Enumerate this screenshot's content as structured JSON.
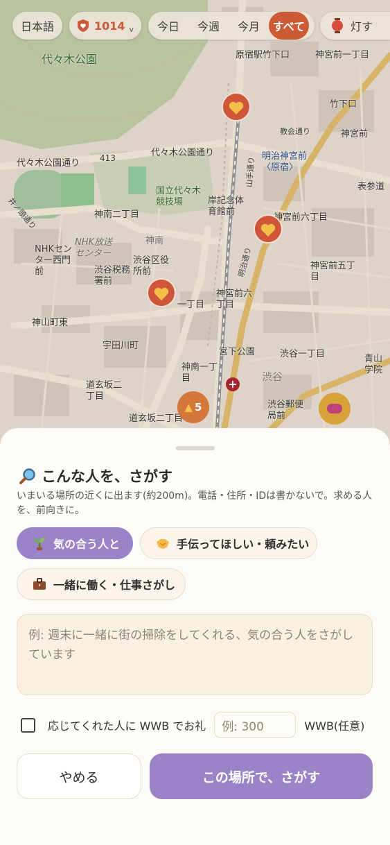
{
  "topbar": {
    "language": "日本語",
    "points": "1014",
    "points_chevron": "v",
    "periods": [
      "今日",
      "今週",
      "今月",
      "すべて"
    ],
    "active_period": "すべて",
    "lantern_label": "灯す"
  },
  "map": {
    "labels": [
      "代々木公園",
      "原宿駅竹下口",
      "神宮前一丁目",
      "竹下口",
      "教会通り",
      "明治神宮前〈原宿〉",
      "神宮前",
      "代々木公園通り",
      "代々木公園通り",
      "413",
      "国立代々木競技場",
      "岸記念体育館前",
      "神宮前六丁目",
      "神南二丁目",
      "神南",
      "NHK放送センター",
      "NHKセンター西門前",
      "渋谷税務署前",
      "渋谷区役所前",
      "神宮前五丁目",
      "神宮前六丁目",
      "一丁目",
      "神山町東",
      "宇田川町",
      "宮下公園",
      "渋谷一丁目",
      "神南一丁目",
      "道玄坂二丁目",
      "渋谷郵便局前",
      "道玄坂二丁目",
      "渋谷",
      "表参道",
      "井ノ頭通り",
      "明治通り",
      "山手通り",
      "青山学院"
    ],
    "cluster_count": "5"
  },
  "sheet": {
    "title": "こんな人を、さがす",
    "description": "いまいる場所の近くに出ます(約200m)。電話・住所・IDは書かないで。求める人を、前向きに。",
    "categories": [
      {
        "label": "気の合う人と",
        "icon": "seedling-icon",
        "active": true
      },
      {
        "label": "手伝ってほしい・頼みたい",
        "icon": "handshake-icon",
        "active": false
      },
      {
        "label": "一緒に働く・仕事さがし",
        "icon": "briefcase-icon",
        "active": false
      }
    ],
    "message_placeholder": "例: 週末に一緒に街の掃除をしてくれる、気の合う人をさがしています",
    "reward_label": "応じてくれた人に WWB でお礼",
    "reward_placeholder": "例: 300",
    "reward_unit": "WWB(任意)",
    "cancel_label": "やめる",
    "submit_label": "この場所で、さがす"
  },
  "colors": {
    "accent_purple": "#9b83c7",
    "accent_orange": "#cb5a35",
    "marker_red": "#d0563a",
    "sheet_bg": "#fdfbf6"
  }
}
